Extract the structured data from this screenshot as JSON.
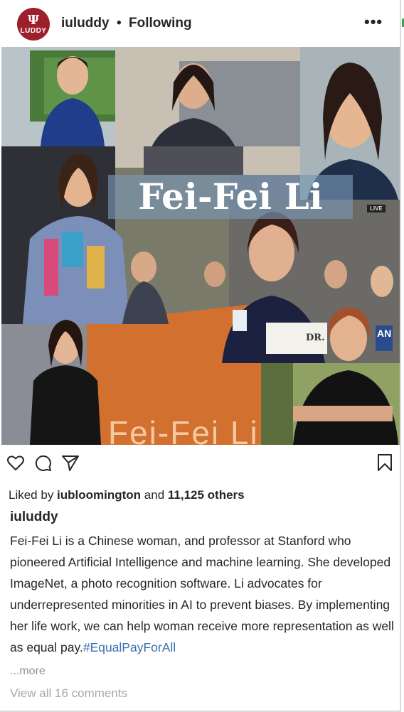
{
  "header": {
    "avatar_text": "LUDDY",
    "avatar_symbol": "Ψ",
    "username": "iuluddy",
    "separator": "•",
    "follow_status": "Following",
    "more_label": "•••"
  },
  "photo": {
    "overlay_title": "Fei-Fei Li",
    "live_label": "LIVE",
    "nameplate": "DR.",
    "stage_text": "Fei-Fei Li",
    "card_text": "AN"
  },
  "actions": {
    "like_icon": "heart-icon",
    "comment_icon": "comment-icon",
    "share_icon": "send-icon",
    "save_icon": "bookmark-icon"
  },
  "likes": {
    "prefix": "Liked by ",
    "user": "iubloomington",
    "middle": " and ",
    "count": "11,125 others"
  },
  "caption": {
    "username": "iuluddy",
    "text": "Fei-Fei Li is a Chinese woman, and professor at Stanford who pioneered Artificial Intelligence and machine learning. She developed ImageNet, a photo recognition software. Li advocates for underrepresented minorities in AI to prevent biases. By implementing her life work, we can help woman receive more representation as well as equal pay.",
    "hashtag": "#EqualPayForAll",
    "more_label": "...more"
  },
  "comments": {
    "view_all_label": "View all 16 comments"
  },
  "colors": {
    "iu_crimson": "#9d1f2a",
    "hashtag_blue": "#3b6fb5",
    "muted_gray": "#8e8e8e"
  }
}
